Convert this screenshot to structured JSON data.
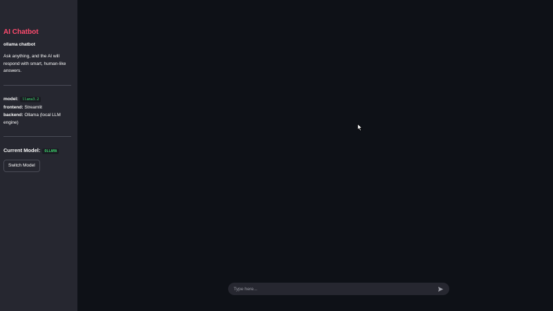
{
  "sidebar": {
    "title": "AI Chatbot",
    "subtitle": "ollama chatbot",
    "description": "Ask anything, and the AI will respond with smart, human-like answers.",
    "info": {
      "model_label": "model:",
      "model_value": "llama3.2",
      "frontend_label": "frontend:",
      "frontend_value": "Streamlit",
      "backend_label": "backend:",
      "backend_value": "Ollama (local LLM engine)"
    },
    "current_model_label": "Current Model:",
    "current_model_value": "OLLAMA",
    "switch_button_label": "Switch Model"
  },
  "chat": {
    "input_placeholder": "Type here...",
    "input_value": ""
  },
  "icons": {
    "send": "send-icon",
    "cursor": "mouse-pointer-icon"
  },
  "colors": {
    "accent": "#ff4b6e",
    "code_green": "#3dd56d",
    "sidebar_bg": "#262730",
    "main_bg": "#0e1117"
  }
}
